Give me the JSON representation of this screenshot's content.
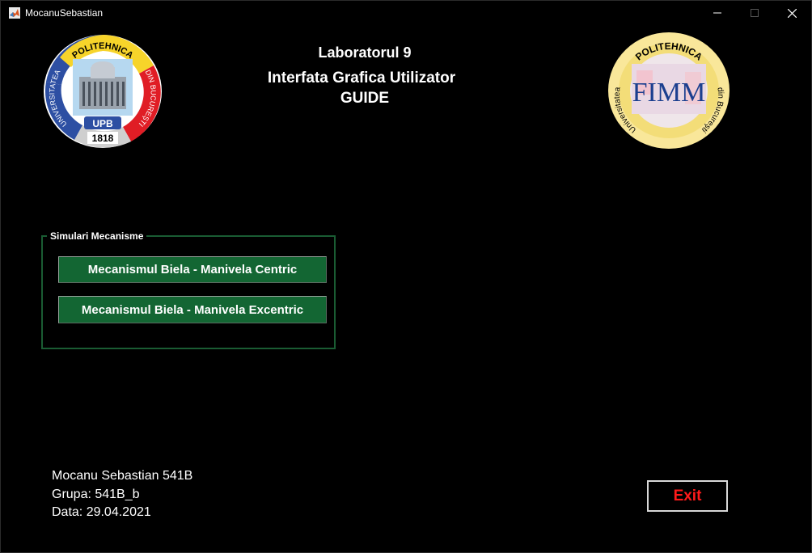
{
  "window": {
    "title": "MocanuSebastian",
    "controls": [
      "minimize-icon",
      "maximize-icon",
      "close-icon"
    ]
  },
  "header": {
    "line1": "Laboratorul 9",
    "line2": "Interfata Grafica Utilizator",
    "line3": "GUIDE"
  },
  "logos": {
    "left": {
      "arc_top": "POLITEHNICA",
      "arc_left": "UNIVERSITATEA",
      "arc_right": "DIN BUCUREŞTI",
      "monogram": "UPB",
      "year": "1818"
    },
    "right": {
      "arc_top": "POLITEHNICA",
      "arc_left": "Universitatea",
      "arc_right": "din Bucureşti",
      "monogram": "FIMM"
    }
  },
  "simulari": {
    "title": "Simulari Mecanisme",
    "button_centric": "Mecanismul Biela - Manivela Centric",
    "button_excentric": "Mecanismul Biela - Manivela Excentric"
  },
  "info": {
    "name": "Mocanu Sebastian 541B",
    "grupa": "Grupa: 541B_b",
    "data": "Data: 29.04.2021"
  },
  "exit_label": "Exit",
  "colors": {
    "background": "#000000",
    "button_green": "#136633",
    "panel_border": "#1a5c33",
    "exit_text": "#ff1a1a"
  }
}
